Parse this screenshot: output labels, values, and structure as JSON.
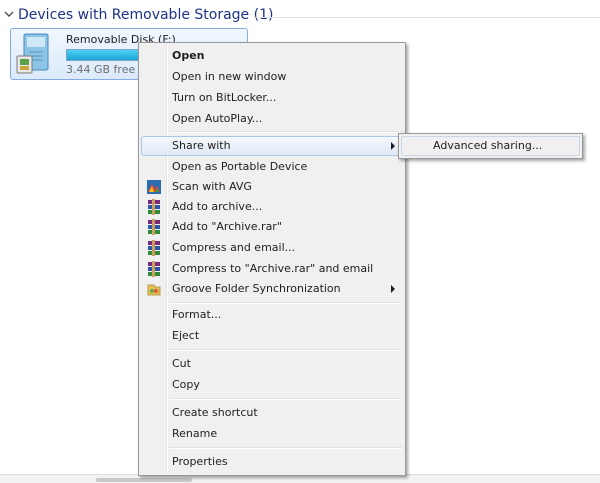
{
  "group": {
    "title": "Devices with Removable Storage (1)"
  },
  "drive": {
    "name": "Removable Disk (F:)",
    "free_text": "3.44 GB free of",
    "usage_fraction": 0.96,
    "icon": "removable-drive-icon"
  },
  "context_menu": {
    "items": [
      {
        "label": "Open"
      },
      {
        "label": "Open in new window"
      },
      {
        "label": "Turn on BitLocker..."
      },
      {
        "label": "Open AutoPlay..."
      },
      {
        "label": "Share with"
      },
      {
        "label": "Open as Portable Device"
      },
      {
        "label": "Scan with AVG"
      },
      {
        "label": "Add to archive..."
      },
      {
        "label": "Add to \"Archive.rar\""
      },
      {
        "label": "Compress and email..."
      },
      {
        "label": "Compress to \"Archive.rar\" and email"
      },
      {
        "label": "Groove Folder Synchronization"
      },
      {
        "label": "Format..."
      },
      {
        "label": "Eject"
      },
      {
        "label": "Cut"
      },
      {
        "label": "Copy"
      },
      {
        "label": "Create shortcut"
      },
      {
        "label": "Rename"
      },
      {
        "label": "Properties"
      }
    ],
    "icons": {
      "avg": "avg-scan-icon",
      "winrar": "winrar-archive-icon",
      "groove": "groove-sync-icon"
    }
  },
  "submenu": {
    "items": [
      {
        "label": "Advanced sharing..."
      }
    ]
  },
  "colors": {
    "group_title": "#1e3287",
    "highlight_border": "#adc6e5",
    "drive_bar_fill": "#1aa5d8",
    "menu_background": "#f0f0f0"
  }
}
